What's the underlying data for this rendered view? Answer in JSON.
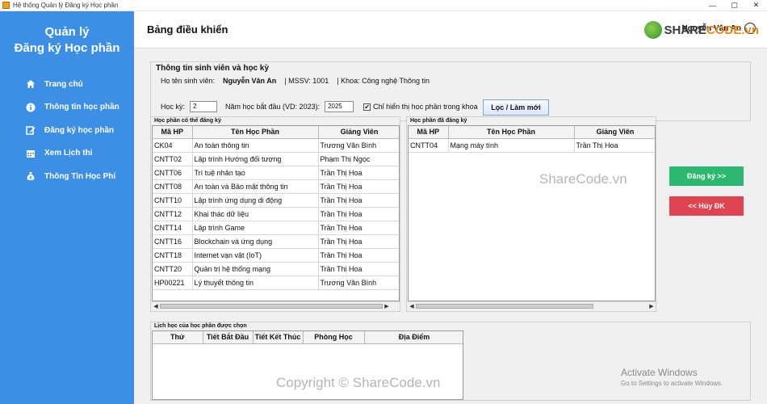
{
  "window": {
    "title": "Hệ thống Quản lý Đăng ký Học phần",
    "buttons": [
      "—",
      "▢",
      "✕"
    ]
  },
  "sidebar": {
    "brand_line1": "Quản lý",
    "brand_line2": "Đăng ký Học phần",
    "items": [
      {
        "label": "Trang chủ",
        "icon": "home-icon"
      },
      {
        "label": "Thông tin học phần",
        "icon": "info-icon"
      },
      {
        "label": "Đăng ký học phần",
        "icon": "edit-icon"
      },
      {
        "label": "Xem Lịch thi",
        "icon": "calendar-icon"
      },
      {
        "label": "Thông Tin Học Phí",
        "icon": "money-bag-icon"
      }
    ],
    "colors": {
      "background": "#3d8fe6"
    }
  },
  "header": {
    "title": "Bảng điều khiển",
    "user_name": "Nguyễn Văn An"
  },
  "info": {
    "legend": "Thông tin sinh viên và học kỳ",
    "name_label": "Họ tên sinh viên:",
    "name_value": "Nguyễn Văn An",
    "mssv": "| MSSV: 1001",
    "khoa": "| Khoa: Công nghệ Thông tin",
    "semester_label": "Học kỳ:",
    "semester_value": "2",
    "year_label": "Năm học bắt đầu (VD: 2023):",
    "year_value": "2025",
    "checkbox_label": "Chỉ hiển thị học phần trong khoa",
    "checkbox_checked": true,
    "filter_button": "Lọc / Làm mới"
  },
  "available": {
    "title": "Học phần có thể đăng ký",
    "columns": [
      "Mã HP",
      "Tên Học Phần",
      "Giảng Viên"
    ],
    "rows": [
      [
        "CK04",
        "An toàn thông tin",
        "Trương Văn Bình"
      ],
      [
        "CNTT02",
        "Lập trình Hướng đối tượng",
        "Phạm Thị Ngọc"
      ],
      [
        "CNTT06",
        "Trí tuệ nhân tạo",
        "Trần Thị Hoa"
      ],
      [
        "CNTT08",
        "An toàn và Bảo mật thông tin",
        "Trần Thị Hoa"
      ],
      [
        "CNTT10",
        "Lập trình ứng dụng di động",
        "Trần Thị Hoa"
      ],
      [
        "CNTT12",
        "Khai thác dữ liệu",
        "Trần Thị Hoa"
      ],
      [
        "CNTT14",
        "Lập trình Game",
        "Trần Thị Hoa"
      ],
      [
        "CNTT16",
        "Blockchain và ứng dụng",
        "Trần Thị Hoa"
      ],
      [
        "CNTT18",
        "Internet vạn vật (IoT)",
        "Trần Thị Hoa"
      ],
      [
        "CNTT20",
        "Quản trị hệ thống mạng",
        "Trần Thị Hoa"
      ],
      [
        "HP00221",
        "Lý thuyết thông tin",
        "Trương Văn Bình"
      ]
    ]
  },
  "registered": {
    "title": "Học phần đã đăng ký",
    "columns": [
      "Mã HP",
      "Tên Học Phần",
      "Giảng Viên"
    ],
    "rows": [
      [
        "CNTT04",
        "Mạng máy tính",
        "Trần Thị Hoa"
      ]
    ]
  },
  "actions": {
    "register": "Đăng ký >>",
    "cancel": "<< Hủy ĐK",
    "colors": {
      "register": "#2db872",
      "cancel": "#e04352"
    }
  },
  "schedule": {
    "title": "Lịch học của học phần được chọn",
    "columns": [
      "Thứ",
      "Tiết Bắt Đầu",
      "Tiết Kết Thúc",
      "Phòng Học",
      "Địa Điểm"
    ]
  },
  "watermarks": {
    "logo_share": "SHARE",
    "logo_code": "CODE.vn",
    "center": "ShareCode.vn",
    "bottom": "Copyright © ShareCode.vn",
    "activate_title": "Activate Windows",
    "activate_sub": "Go to Settings to activate Windows."
  }
}
